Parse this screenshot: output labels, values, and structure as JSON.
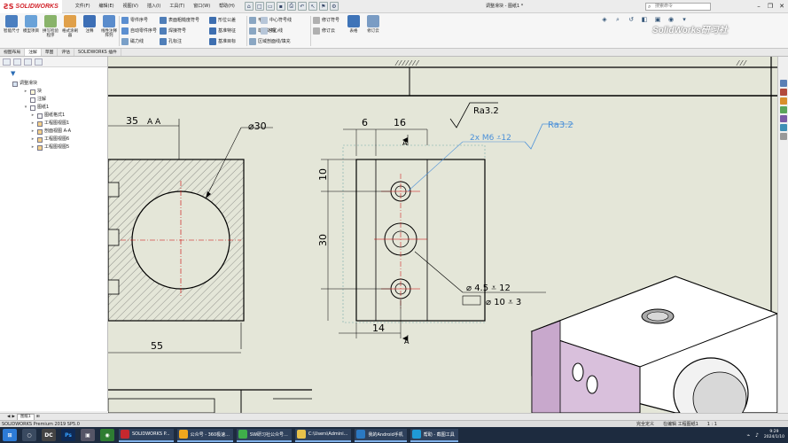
{
  "app": {
    "brand": "SOLIDWORKS",
    "menu": [
      "文件(F)",
      "编辑(E)",
      "视图(V)",
      "插入(I)",
      "工具(T)",
      "窗口(W)",
      "帮助(H)"
    ],
    "document_title": "调整滑块 - 图纸1 *",
    "search_placeholder": "搜索命令",
    "watermark": "SolidWorks研习社"
  },
  "ribbon": {
    "big_buttons": [
      "智能尺寸",
      "模型项目",
      "拼写检验程序",
      "格式涂刷器",
      "注释",
      "线性注释阵列",
      "表格",
      "修订云"
    ],
    "column1": [
      "零件序号",
      "自动零件序号",
      "磁力线"
    ],
    "column2": [
      "表面粗糙度符号",
      "焊接符号",
      "孔标注"
    ],
    "column3": [
      "形位公差",
      "基准特征",
      "基准目标"
    ],
    "column4": [
      "毛虫",
      "端点处理",
      "区域剖面线/填充"
    ],
    "column5": [
      "中心符号线",
      "中心线"
    ],
    "column6": [
      "修订符号",
      "修订云"
    ]
  },
  "command_tabs": [
    {
      "label": "视图布局",
      "active": false
    },
    {
      "label": "注解",
      "active": true
    },
    {
      "label": "草图",
      "active": false
    },
    {
      "label": "评估",
      "active": false
    },
    {
      "label": "SOLIDWORKS 插件",
      "active": false
    }
  ],
  "feature_tree": {
    "items": [
      {
        "label": "调整滑块",
        "indent": 0,
        "expander": ""
      },
      {
        "label": "块",
        "indent": 1,
        "expander": "▸"
      },
      {
        "label": "注解",
        "indent": 1,
        "expander": ""
      },
      {
        "label": "图纸1",
        "indent": 1,
        "expander": "▾"
      },
      {
        "label": "图纸格式1",
        "indent": 2,
        "expander": "▸"
      },
      {
        "label": "工程图视图1",
        "indent": 2,
        "expander": "▸"
      },
      {
        "label": "剖面视图 A-A",
        "indent": 2,
        "expander": "▸"
      },
      {
        "label": "工程图视图6",
        "indent": 2,
        "expander": "▸"
      },
      {
        "label": "工程图视图5",
        "indent": 2,
        "expander": "▸"
      }
    ]
  },
  "drawing": {
    "section_label": "A A",
    "dim_35": "35",
    "dim_phi30": "⌀30",
    "dim_55": "55",
    "dim_6": "6",
    "dim_16": "16",
    "dim_10": "10",
    "dim_30": "30",
    "dim_14": "14",
    "section_arrow_a": "A",
    "roughness_1": "Ra3.2",
    "roughness_2": "Ra3.2",
    "hole_callout": "2x M6 ⩡12",
    "callout_line1": "⌀ 4.5 ⩡ 12",
    "callout_line2": "⌀ 10 ⩡ 3"
  },
  "sheet_tabs": [
    "图纸1"
  ],
  "status": {
    "left": "SOLIDWORKS Premium 2019 SP5.0",
    "right": [
      "完全定义",
      "在编辑 工程图纸1",
      "1 : 1"
    ]
  },
  "taskbar": {
    "tasks": [
      "SOLIDWORKS P...",
      "公众号 - 360极速...",
      "SW研习社公众号...",
      "C:\\Users\\Admini...",
      "我的Android手机",
      "帮助 - 截图工具"
    ],
    "time": "9:29",
    "date": "2024/1/10"
  }
}
